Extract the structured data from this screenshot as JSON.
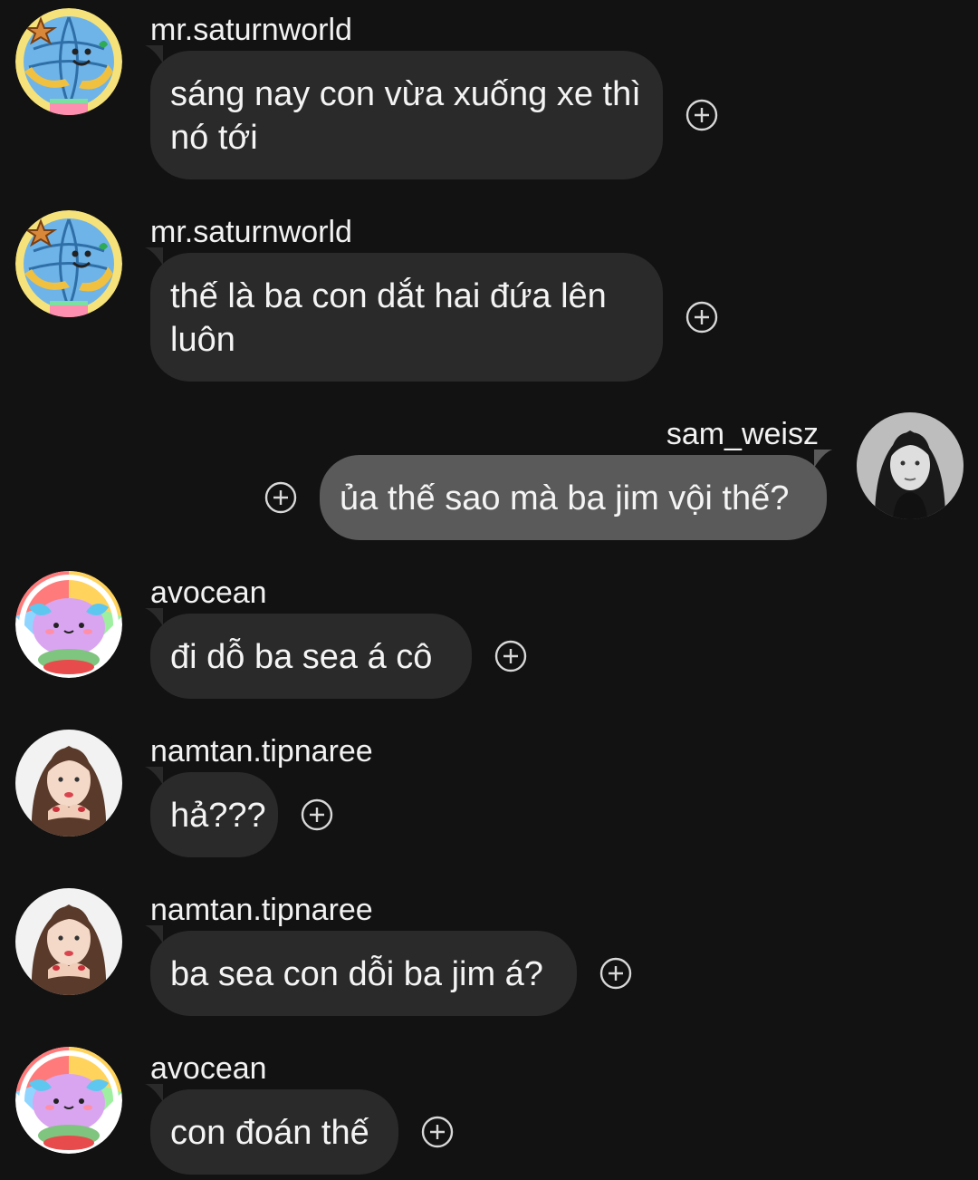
{
  "messages": [
    {
      "username": "mr.saturnworld",
      "text": "sáng nay con vừa xuống xe thì nó tới",
      "avatar_icon": "globe-cartoon-icon"
    },
    {
      "username": "mr.saturnworld",
      "text": "thế là ba con dắt hai đứa lên luôn",
      "avatar_icon": "globe-cartoon-icon"
    },
    {
      "username": "sam_weisz",
      "text": "ủa thế sao mà ba jim vội thế?",
      "avatar_icon": "woman-portrait-icon"
    },
    {
      "username": "avocean",
      "text": "đi dỗ ba sea á cô",
      "avatar_icon": "axolotl-cartoon-icon"
    },
    {
      "username": "namtan.tipnaree",
      "text": "hả???",
      "avatar_icon": "woman-portrait-icon"
    },
    {
      "username": "namtan.tipnaree",
      "text": "ba sea con dỗi ba jim á?",
      "avatar_icon": "woman-portrait-icon"
    },
    {
      "username": "avocean",
      "text": "con đoán thế",
      "avatar_icon": "axolotl-cartoon-icon"
    }
  ],
  "react_icon": "add-reaction-icon",
  "colors": {
    "background": "#121212",
    "bubble_other": "#2a2a2a",
    "bubble_mine": "#5a5a5a",
    "text": "#f4f4f4"
  }
}
